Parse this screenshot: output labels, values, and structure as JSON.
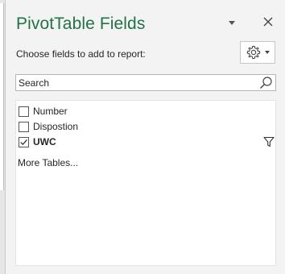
{
  "pane": {
    "title": "PivotTable Fields",
    "choose_label": "Choose fields to add to report:",
    "settings_icon": "gear-icon",
    "close_icon": "close-icon"
  },
  "search": {
    "placeholder": "Search",
    "value": ""
  },
  "fields": [
    {
      "label": "Number",
      "checked": false,
      "bold": false,
      "filtered": false
    },
    {
      "label": "Dispostion",
      "checked": false,
      "bold": false,
      "filtered": false
    },
    {
      "label": "UWC",
      "checked": true,
      "bold": true,
      "filtered": true
    }
  ],
  "more_tables": "More Tables...",
  "colors": {
    "title": "#217346",
    "pane_bg": "#f3f3f3",
    "list_bg": "#ffffff"
  }
}
